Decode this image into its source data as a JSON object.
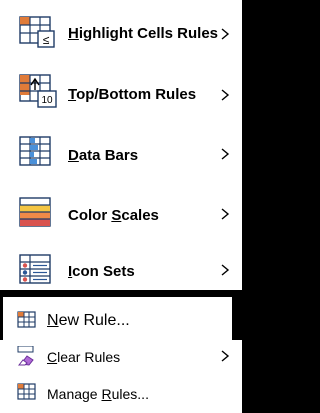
{
  "menu": {
    "items": [
      {
        "label_pre": "",
        "label_key": "H",
        "label_post": "ighlight Cells Rules",
        "icon": "highlight-cells-icon",
        "has_submenu": true
      },
      {
        "label_pre": "",
        "label_key": "T",
        "label_post": "op/Bottom Rules",
        "icon": "top-bottom-icon",
        "has_submenu": true,
        "icon_text": "10"
      },
      {
        "label_pre": "",
        "label_key": "D",
        "label_post": "ata Bars",
        "icon": "data-bars-icon",
        "has_submenu": true
      },
      {
        "label_pre": "Color ",
        "label_key": "S",
        "label_post": "cales",
        "icon": "color-scales-icon",
        "has_submenu": true
      },
      {
        "label_pre": "",
        "label_key": "I",
        "label_post": "con Sets",
        "icon": "icon-sets-icon",
        "has_submenu": true
      }
    ],
    "commands": [
      {
        "label_pre": "",
        "label_key": "N",
        "label_post": "ew Rule...",
        "icon": "new-rule-icon",
        "has_submenu": false
      },
      {
        "label_pre": "",
        "label_key": "C",
        "label_post": "lear Rules",
        "icon": "clear-rules-icon",
        "has_submenu": true
      },
      {
        "label_pre": "Manage ",
        "label_key": "R",
        "label_post": "ules...",
        "icon": "manage-rules-icon",
        "has_submenu": false
      }
    ]
  },
  "colors": {
    "grid_blue": "#2b5797",
    "orange": "#e07b39",
    "data_bar_blue": "#4a90d9",
    "scale_yellow": "#f4c542",
    "scale_red": "#d9534f",
    "scale_orange": "#ef8a48",
    "frame": "#000000"
  }
}
